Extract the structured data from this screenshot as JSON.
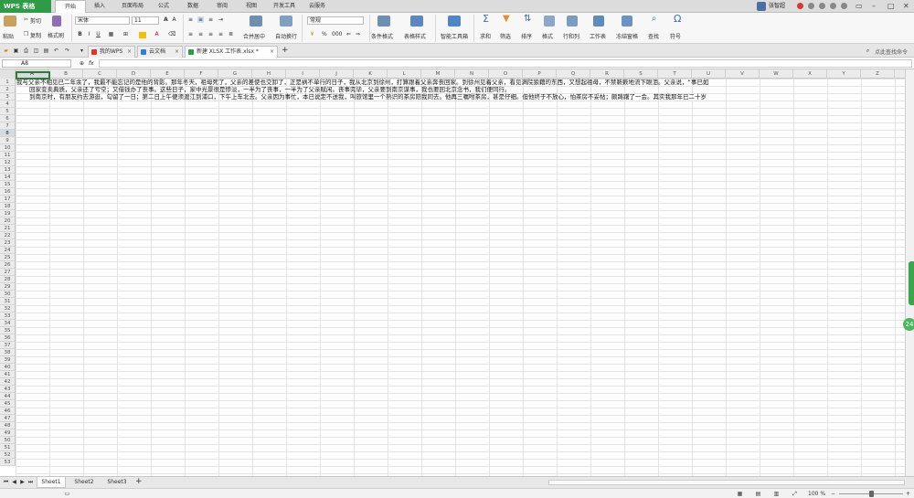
{
  "app": {
    "name": "WPS 表格",
    "menu_tabs": [
      "开始",
      "插入",
      "页面布局",
      "公式",
      "数据",
      "审阅",
      "视图",
      "开发工具",
      "云服务"
    ],
    "active_menu": "开始",
    "user_name": "张智超"
  },
  "ribbon": {
    "paste": "粘贴",
    "cut": "剪切",
    "copy": "复制",
    "format_painter": "格式刷",
    "font_name": "宋体",
    "font_size": "11",
    "merge_center": "合并居中",
    "wrap_text": "自动换行",
    "number_format": "常规",
    "conditional_format": "条件格式",
    "table_style": "表格样式",
    "smart_toolbox": "智能工具箱",
    "sum": "求和",
    "filter": "筛选",
    "sort": "排序",
    "format": "格式",
    "row_col": "行和列",
    "worksheet": "工作表",
    "freeze_panes": "冻结窗格",
    "find": "查找",
    "symbol": "符号",
    "percent": "%",
    "thousands": "000"
  },
  "doc_tabs": [
    {
      "label": "我的WPS",
      "color": "#d9382f"
    },
    {
      "label": "云文档",
      "color": "#2f7fd9"
    },
    {
      "label": "新建 XLSX 工作表.xlsx *",
      "color": "#2e9b46"
    }
  ],
  "active_doc_tab": 2,
  "search_placeholder": "点此查找命令",
  "formula_bar": {
    "name_box": "A8",
    "fx": "fx"
  },
  "columns": [
    "A",
    "B",
    "C",
    "D",
    "E",
    "F",
    "G",
    "H",
    "I",
    "J",
    "K",
    "L",
    "M",
    "N",
    "O",
    "P",
    "Q",
    "R",
    "S",
    "T",
    "U",
    "V",
    "W",
    "X",
    "Y",
    "Z"
  ],
  "row_numbers": [
    "1",
    "2",
    "3",
    "4",
    "5",
    "6",
    "7",
    "8",
    "9",
    "10",
    "11",
    "12",
    "13",
    "14",
    "15",
    "16",
    "17",
    "18",
    "19",
    "20",
    "21",
    "22",
    "23",
    "24",
    "25",
    "26",
    "27",
    "28",
    "29",
    "30",
    "31",
    "32",
    "33",
    "34",
    "35",
    "36",
    "37",
    "38",
    "39",
    "40",
    "41",
    "42",
    "43",
    "44",
    "45",
    "46",
    "47",
    "48",
    "49",
    "50",
    "51",
    "52",
    "53"
  ],
  "selected_cell": {
    "col": "A",
    "row": "8"
  },
  "cells": {
    "r1": "我与父亲不相见已二年余了，我最不能忘记的是他的背影。那年冬天，祖母死了，父亲的差使也交卸了，正是祸不单行的日子，我从北京到徐州，打算跟着父亲奔丧回家。到徐州见着父亲，看见满院狼藉的东西，又想起祖母，不禁簌簌地流下眼泪。父亲说，“事已如",
    "r2": "回家变卖典质，父亲还了亏空；又借钱办了丧事。这些日子，家中光景很是惨淡，一半为了丧事，一半为了父亲赋闲。丧事完毕，父亲要到南京谋事，我也要回北京念书，我们便同行。",
    "r3": "到南京时，有朋友约去游逛，勾留了一日；第二日上午便须渡江到浦口，下午上车北去。父亲因为事忙，本已说定不送我，叫旅馆里一个熟识的茶房陪我同去。他再三嘱咐茶房，甚是仔细。但他终于不放心，怕茶房不妥帖；颇踌躇了一会。其实我那年已二十岁"
  },
  "sheets": [
    "Sheet1",
    "Sheet2",
    "Sheet3"
  ],
  "active_sheet": "Sheet1",
  "status": {
    "zoom": "100 %"
  },
  "side_bubble": "24"
}
